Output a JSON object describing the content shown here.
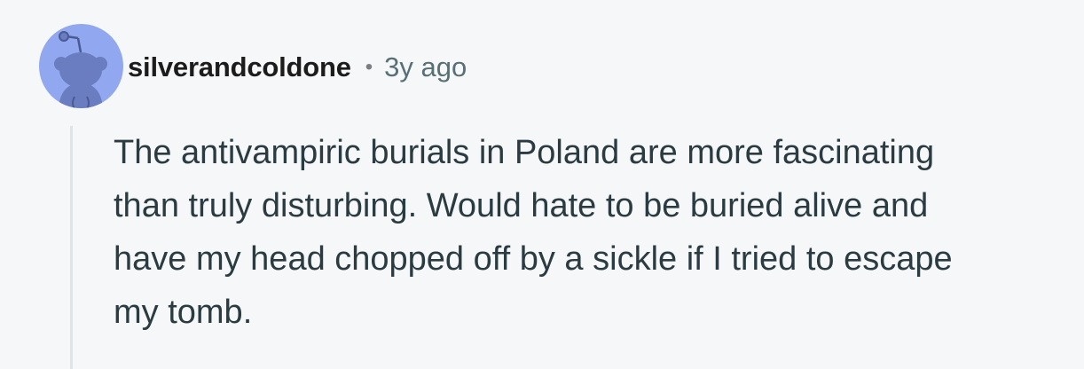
{
  "comment": {
    "author": "silverandcoldone",
    "separator": "•",
    "timestamp": "3y ago",
    "avatar_icon": "reddit-snoo-avatar-icon",
    "avatar_color": "#91a7f0",
    "body": "The antivampiric burials in Poland are more fascinating than truly disturbing. Would hate to be buried alive and have my head chopped off by a sickle if I tried to escape my tomb."
  }
}
